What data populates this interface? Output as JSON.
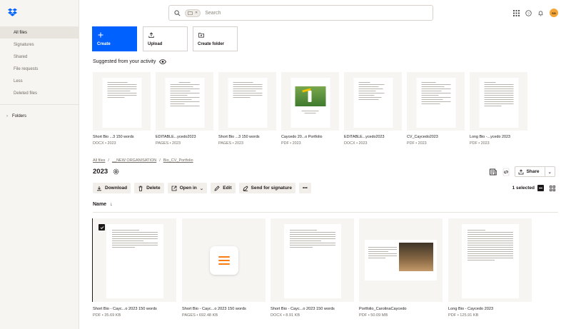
{
  "sidebar": {
    "items": [
      {
        "label": "All files",
        "active": true
      },
      {
        "label": "Signatures"
      },
      {
        "label": "Shared"
      },
      {
        "label": "File requests"
      },
      {
        "label": "Less"
      },
      {
        "label": "Deleted files"
      }
    ],
    "folders_label": "Folders"
  },
  "search": {
    "placeholder": "Search"
  },
  "user": {
    "initials": "SG"
  },
  "actions": {
    "create": "Create",
    "upload": "Upload",
    "create_folder": "Create folder"
  },
  "suggested": {
    "title": "Suggested from your activity",
    "cards": [
      {
        "name": "Short Bio ...3 150 words",
        "meta": "DOCX • 2023"
      },
      {
        "name": "EDITABLE...ycedo2023",
        "meta": "PAGES • 2023"
      },
      {
        "name": "Short Bio ...3 150 words",
        "meta": "PAGES • 2023"
      },
      {
        "name": "Caycedo 20...o Portfolio",
        "meta": "PDF • 2023"
      },
      {
        "name": "EDITABLE...ycedo2023",
        "meta": "DOCX • 2023"
      },
      {
        "name": "CV_Caycedo2023",
        "meta": "PDF • 2023"
      },
      {
        "name": "Long Bio -...ycedo 2023",
        "meta": "PDF • 2023"
      }
    ]
  },
  "breadcrumb": [
    "All files",
    "/",
    "__NEW ORGANISATION",
    "/",
    "Bio_CV_Portfolio"
  ],
  "folder": {
    "title": "2023"
  },
  "share_label": "Share",
  "toolbar": {
    "download": "Download",
    "delete": "Delete",
    "open_in": "Open in",
    "edit": "Edit",
    "send_sig": "Send for signature"
  },
  "selection": "1 selected",
  "list_header": "Name",
  "files": [
    {
      "name": "Short Bio - Cayc...o 2023 150 words",
      "meta": "PDF • 35.69 KB"
    },
    {
      "name": "Short Bio - Cayc...o 2023 150 words",
      "meta": "PAGES • 692.48 KB"
    },
    {
      "name": "Short Bio - Cayc...o 2023 150 words",
      "meta": "DOCX • 8.91 KB"
    },
    {
      "name": "Portfolio_CarolinaCaycedo",
      "meta": "PDF • 50.09 MB"
    },
    {
      "name": "Long Bio - Caycedo 2023",
      "meta": "PDF • 125.91 KB"
    }
  ],
  "colors": {
    "accent": "#0061fe",
    "pages_orange": "#f97d10",
    "avatar": "#f4a537"
  }
}
